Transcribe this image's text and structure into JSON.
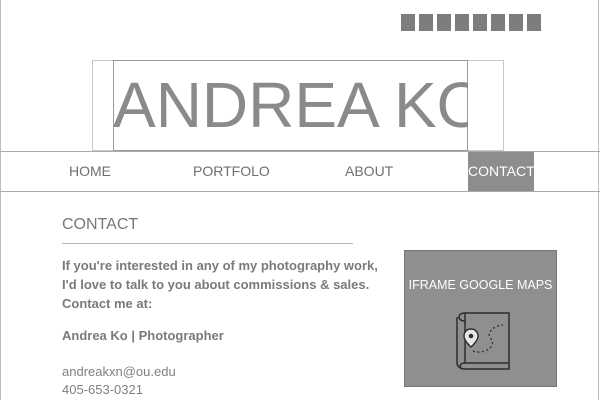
{
  "header": {
    "logo_text": "ANDREA KO",
    "social_icons": [
      "social-icon-1",
      "social-icon-2",
      "social-icon-3",
      "social-icon-4",
      "social-icon-5",
      "social-icon-6",
      "social-icon-7",
      "social-icon-8"
    ]
  },
  "nav": {
    "home": "HOME",
    "portfolio": "PORTFOLO",
    "about": "ABOUT",
    "contact": "CONTACT",
    "active": "CONTACT"
  },
  "contact": {
    "title": "CONTACT",
    "intro_lines": [
      "If you're interested in any of my photography work,",
      "I'd love to talk to you about commissions & sales.",
      "Contact me at:"
    ],
    "signature": "Andrea Ko | Photographer",
    "email": "andreakxn@ou.edu",
    "phone": "405-653-0321"
  },
  "map": {
    "label": "IFRAME GOOGLE MAPS",
    "icon": "map-pin-icon"
  },
  "colors": {
    "active_nav_bg": "#8d8d8d",
    "map_bg": "#8f8f8f",
    "text_gray": "#6f6f6f"
  }
}
